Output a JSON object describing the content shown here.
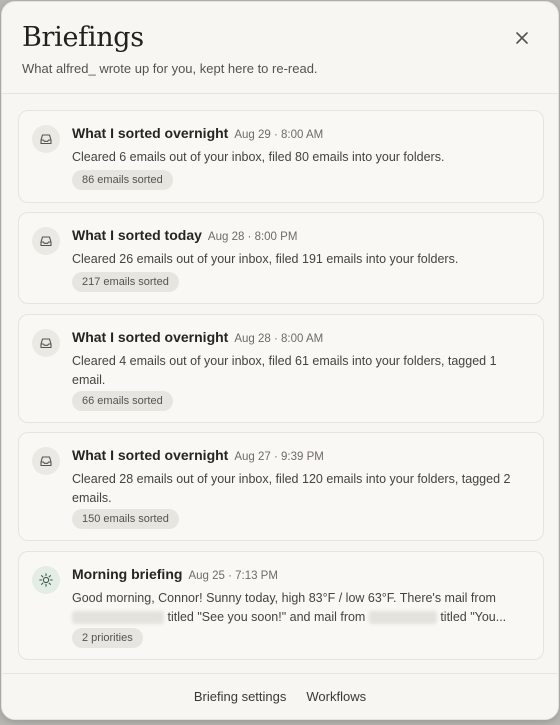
{
  "header": {
    "title": "Briefings",
    "subtitle": "What alfred_ wrote up for you, kept here to re-read.",
    "close_icon": "close-icon"
  },
  "briefings": [
    {
      "icon": "inbox-icon",
      "title": "What I sorted overnight",
      "date": "Aug 29 · 8:00 AM",
      "summary": "Cleared 6 emails out of your inbox, filed 80 emails into your folders.",
      "tag": "86 emails sorted"
    },
    {
      "icon": "inbox-icon",
      "title": "What I sorted today",
      "date": "Aug 28 · 8:00 PM",
      "summary": "Cleared 26 emails out of your inbox, filed 191 emails into your folders.",
      "tag": "217 emails sorted"
    },
    {
      "icon": "inbox-icon",
      "title": "What I sorted overnight",
      "date": "Aug 28 · 8:00 AM",
      "summary": "Cleared 4 emails out of your inbox, filed 61 emails into your folders, tagged 1 email.",
      "tag": "66 emails sorted"
    },
    {
      "icon": "inbox-icon",
      "title": "What I sorted overnight",
      "date": "Aug 27 · 9:39 PM",
      "summary": "Cleared 28 emails out of your inbox, filed 120 emails into your folders, tagged 2 emails.",
      "tag": "150 emails sorted"
    },
    {
      "icon": "sun-icon",
      "title": "Morning briefing",
      "date": "Aug 25 · 7:13 PM",
      "summary_line1": "Good morning, Connor! Sunny today, high 83°F / low 63°F. There's mail from",
      "summary_part2": "titled \"See you soon!\" and mail from",
      "summary_part3": "titled \"You...",
      "tag": "2 priorities"
    }
  ],
  "footer": {
    "settings_label": "Briefing settings",
    "workflows_label": "Workflows"
  }
}
